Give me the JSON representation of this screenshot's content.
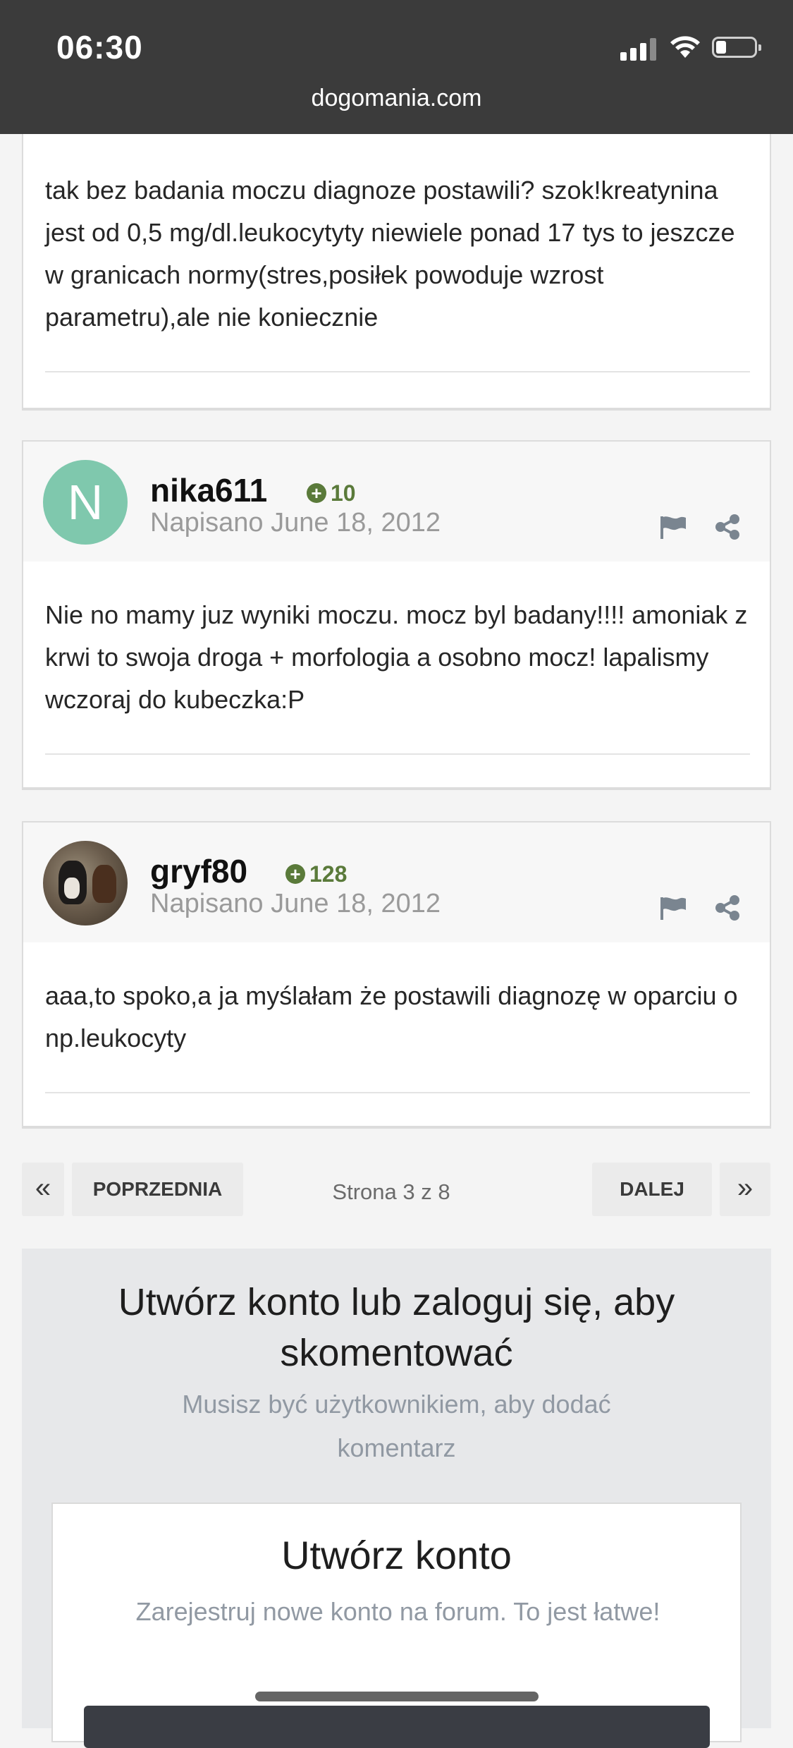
{
  "status_bar": {
    "time": "06:30",
    "url": "dogomania.com"
  },
  "posts": [
    {
      "text": "tak bez badania moczu diagnoze postawili? szok!kreatynina jest od 0,5 mg/dl.leukocytyty niewiele ponad 17 tys to jeszcze w granicach normy(stres,posiłek powoduje wzrost parametru),ale nie koniecznie"
    },
    {
      "avatar_letter": "N",
      "username": "nika611",
      "reputation": "10",
      "date": "Napisano June 18, 2012",
      "text": "Nie no mamy juz wyniki moczu. mocz byl badany!!!! amoniak z krwi to swoja droga + morfologia a osobno mocz! lapalismy wczoraj do kubeczka:P"
    },
    {
      "username": "gryf80",
      "reputation": "128",
      "date": "Napisano June 18, 2012",
      "text": "aaa,to spoko,a ja myślałam że postawili diagnozę w oparciu o np.leukocyty"
    }
  ],
  "pagination": {
    "first": "«",
    "prev": "POPRZEDNIA",
    "info": "Strona 3 z 8",
    "next": "DALEJ",
    "last": "»"
  },
  "signup": {
    "title": "Utwórz konto lub zaloguj się, aby skomentować",
    "subtitle": "Musisz być użytkownikiem, aby dodać komentarz",
    "create_title": "Utwórz konto",
    "create_subtitle": "Zarejestruj nowe konto na forum. To jest łatwe!"
  },
  "colors": {
    "accent_green": "#5a7a3a",
    "avatar_bg": "#7fc8ad",
    "status_bar": "#3b3b3b"
  }
}
